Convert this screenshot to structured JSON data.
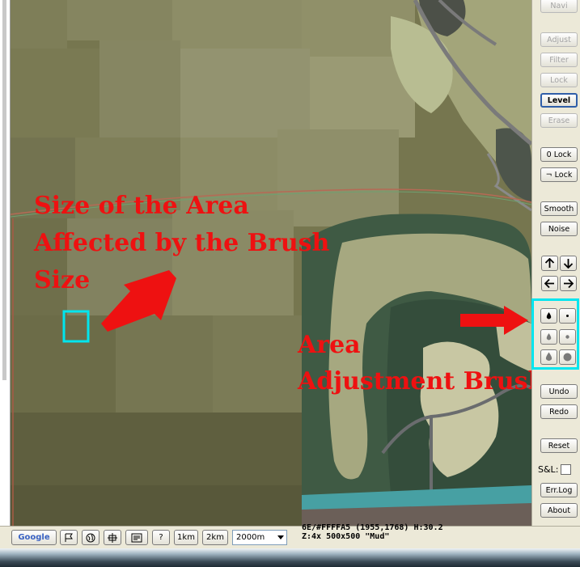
{
  "toolbar": {
    "navi": "Navi",
    "adjust": "Adjust",
    "filter": "Filter",
    "lock": "Lock",
    "level": "Level",
    "erase": "Erase",
    "zero_lock": "0 Lock",
    "not_lock": "¬ Lock",
    "smooth": "Smooth",
    "noise": "Noise",
    "undo": "Undo",
    "redo": "Redo",
    "reset": "Reset",
    "sl_label": "S&L:",
    "errlog": "Err.Log",
    "about": "About"
  },
  "arrows": {
    "up": "up-arrow-icon",
    "down": "down-arrow-icon",
    "left": "left-arrow-icon",
    "right": "right-arrow-icon"
  },
  "brushes": [
    "brush-drop-black-icon",
    "brush-dot-small-icon",
    "brush-drop-gray-icon",
    "brush-dot-medium-icon",
    "brush-drop-gray-large-icon",
    "brush-dot-large-icon"
  ],
  "statusbar": {
    "google": "Google",
    "zoom_1km": "1km",
    "zoom_2km": "2km",
    "zoom_selected": "2000m",
    "help": "?",
    "coords_line": "6E/#FFFFA5 (1955,1768) H:30.2",
    "info_line": "Z:4x 500x500 \"Mud\""
  },
  "annotations": {
    "brush_size_l1": "Size of the Area",
    "brush_size_l2": "Affected by the Brush",
    "brush_size_l3": "Size",
    "brushes_l1": "Area",
    "brushes_l2": "Adjustment Brushes"
  },
  "colors": {
    "annotation_red": "#ee1111",
    "highlight_cyan": "#00e5ee",
    "terrain_olive": "#7c7c55",
    "terrain_dark_green": "#3f5a44",
    "water_teal": "#47a0a3"
  }
}
